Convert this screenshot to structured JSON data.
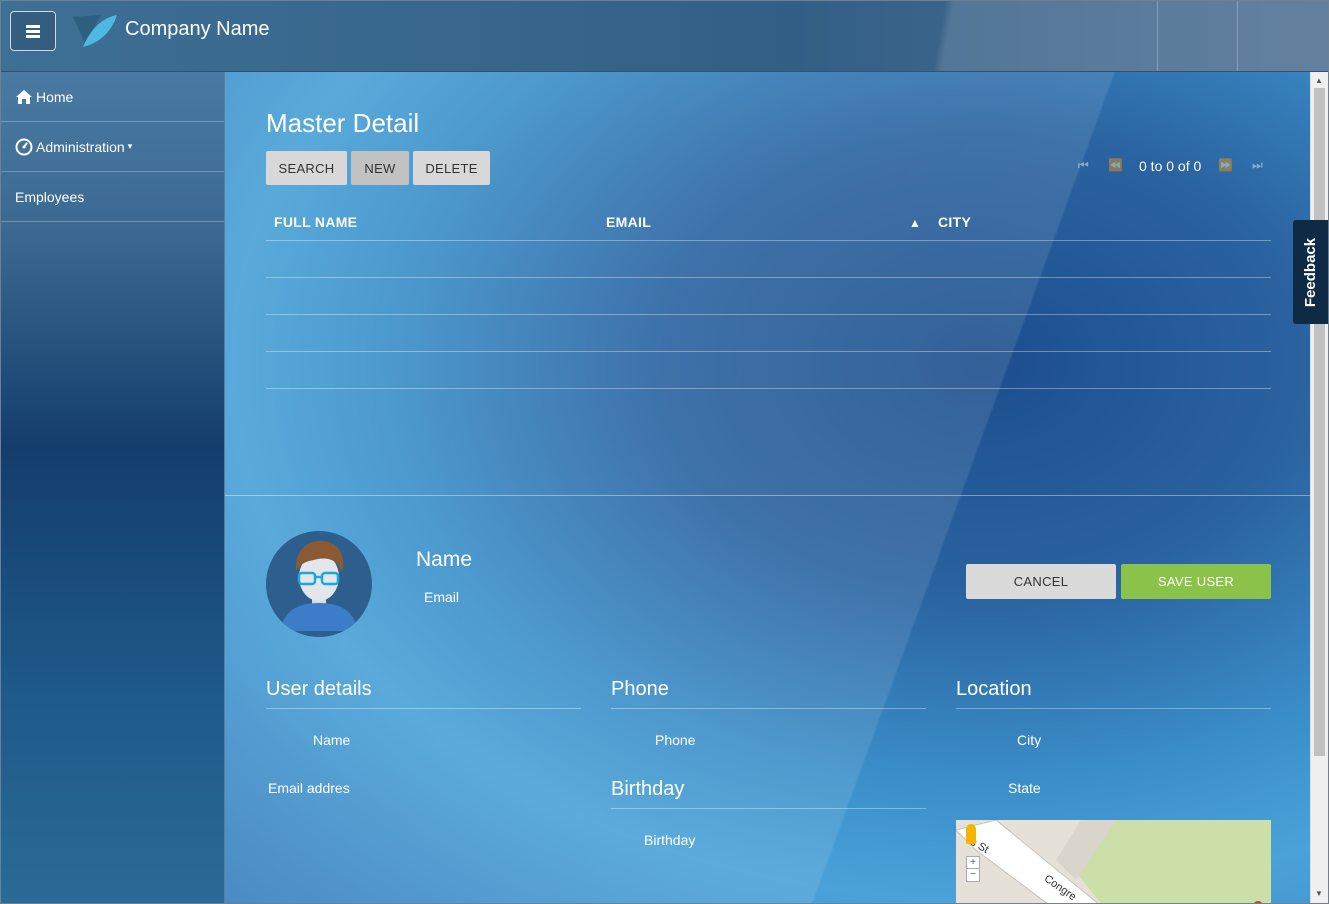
{
  "header": {
    "company_name": "Company Name",
    "menu_icon": "hamburger-icon"
  },
  "sidebar": {
    "items": [
      {
        "label": "Home",
        "icon": "home-icon"
      },
      {
        "label": "Administration",
        "icon": "dashboard-icon"
      },
      {
        "label": "Employees"
      }
    ]
  },
  "main": {
    "title": "Master Detail",
    "buttons": {
      "search": "SEARCH",
      "new": "NEW",
      "delete": "DELETE"
    },
    "pager": {
      "text": "0 to 0 of 0"
    },
    "columns": {
      "full_name": "FULL NAME",
      "email": "EMAIL",
      "city": "CITY",
      "sort_indicator": "▲"
    }
  },
  "detail": {
    "name": "Name",
    "email": "Email",
    "cancel_label": "CANCEL",
    "save_label": "SAVE USER",
    "sections": {
      "user_details": "User details",
      "phone": "Phone",
      "birthday": "Birthday",
      "location": "Location"
    },
    "fields": {
      "name": "Name",
      "email": "Email addres",
      "phone": "Phone",
      "birthday": "Birthday",
      "city": "City",
      "state": "State"
    },
    "map": {
      "street1": "s St",
      "street2": "Congre"
    }
  },
  "feedback": {
    "label": "Feedback"
  },
  "colors": {
    "save": "#8bc34a",
    "button": "#d8d8d8",
    "feedback": "#0e2a45"
  }
}
